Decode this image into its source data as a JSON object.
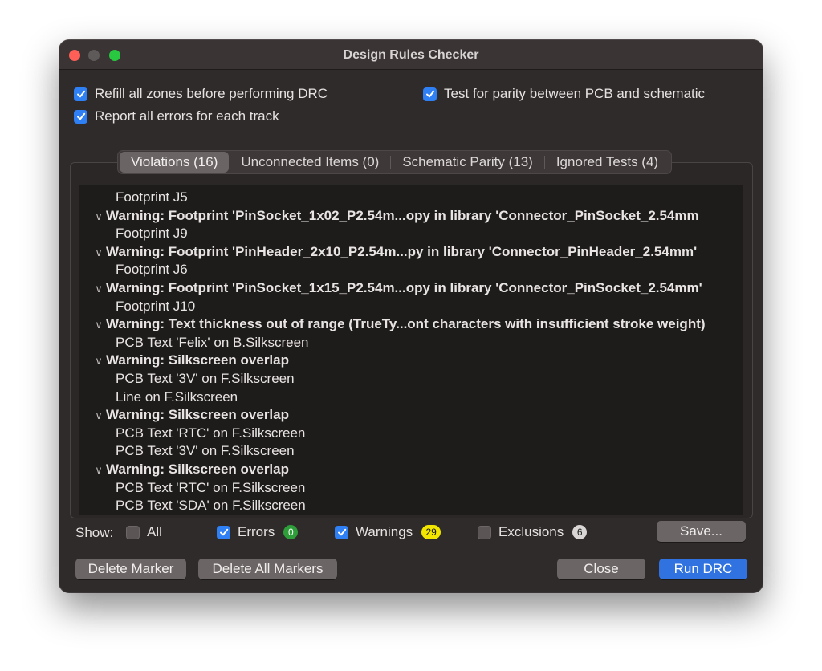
{
  "window": {
    "title": "Design Rules Checker"
  },
  "options": {
    "refill_zones": {
      "label": "Refill all zones before performing DRC",
      "checked": true
    },
    "report_all_errors": {
      "label": "Report all errors for each track",
      "checked": true
    },
    "test_parity": {
      "label": "Test for parity between PCB and schematic",
      "checked": true
    }
  },
  "tabs": [
    {
      "label": "Violations (16)",
      "active": true
    },
    {
      "label": "Unconnected Items (0)",
      "active": false
    },
    {
      "label": "Schematic Parity (13)",
      "active": false
    },
    {
      "label": "Ignored Tests (4)",
      "active": false
    }
  ],
  "violations": [
    {
      "type": "item",
      "text": "Footprint J5"
    },
    {
      "type": "warning",
      "text": "Warning: Footprint 'PinSocket_1x02_P2.54m...opy in library 'Connector_PinSocket_2.54mm"
    },
    {
      "type": "item",
      "text": "Footprint J9"
    },
    {
      "type": "warning",
      "text": "Warning: Footprint 'PinHeader_2x10_P2.54m...py in library 'Connector_PinHeader_2.54mm'"
    },
    {
      "type": "item",
      "text": "Footprint J6"
    },
    {
      "type": "warning",
      "text": "Warning: Footprint 'PinSocket_1x15_P2.54m...opy in library 'Connector_PinSocket_2.54mm'"
    },
    {
      "type": "item",
      "text": "Footprint J10"
    },
    {
      "type": "warning",
      "text": "Warning: Text thickness out of range (TrueTy...ont characters with insufficient stroke weight)"
    },
    {
      "type": "item",
      "text": "PCB Text 'Felix' on B.Silkscreen"
    },
    {
      "type": "warning",
      "text": "Warning: Silkscreen overlap"
    },
    {
      "type": "item",
      "text": "PCB Text '3V' on F.Silkscreen"
    },
    {
      "type": "item",
      "text": "Line on F.Silkscreen"
    },
    {
      "type": "warning",
      "text": "Warning: Silkscreen overlap"
    },
    {
      "type": "item",
      "text": "PCB Text 'RTC' on F.Silkscreen"
    },
    {
      "type": "item",
      "text": "PCB Text '3V' on F.Silkscreen"
    },
    {
      "type": "warning",
      "text": "Warning: Silkscreen overlap"
    },
    {
      "type": "item",
      "text": "PCB Text 'RTC' on F.Silkscreen"
    },
    {
      "type": "item",
      "text": "PCB Text 'SDA' on F.Silkscreen"
    }
  ],
  "filters": {
    "show_label": "Show:",
    "all": {
      "label": "All",
      "checked": false
    },
    "errors": {
      "label": "Errors",
      "checked": true,
      "count": "0",
      "color": "#2e9e3a"
    },
    "warnings": {
      "label": "Warnings",
      "checked": true,
      "count": "29",
      "color": "#f2e600"
    },
    "exclusions": {
      "label": "Exclusions",
      "checked": false,
      "count": "6",
      "color": "#d9d6d5"
    }
  },
  "buttons": {
    "save": "Save...",
    "delete_marker": "Delete Marker",
    "delete_all_markers": "Delete All Markers",
    "close": "Close",
    "run_drc": "Run DRC"
  },
  "colors": {
    "accent": "#2f7ff5",
    "primary_button": "#2f72e0"
  }
}
